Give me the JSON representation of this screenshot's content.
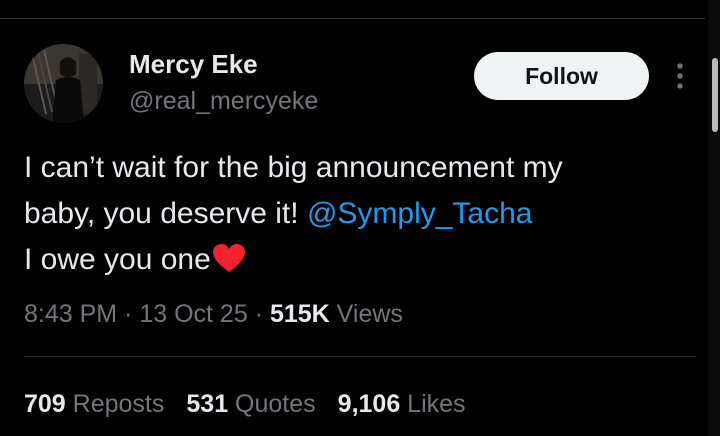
{
  "author": {
    "display_name": "Mercy Eke",
    "handle": "@real_mercyeke"
  },
  "actions": {
    "follow_label": "Follow"
  },
  "tweet": {
    "line1": "I can’t wait for the big announcement my",
    "line2_text": "baby, you deserve it! ",
    "mention": "@Symply_Tacha",
    "line3": "I owe you one",
    "emoji": "heart-emoji"
  },
  "meta": {
    "time": "8:43 PM",
    "sep1": " · ",
    "date": "13 Oct 25",
    "sep2": " · ",
    "views_count": "515K",
    "views_label": " Views"
  },
  "stats": {
    "reposts_count": "709",
    "reposts_label": " Reposts",
    "quotes_count": "531",
    "quotes_label": " Quotes",
    "likes_count": "9,106",
    "likes_label": " Likes"
  },
  "colors": {
    "background": "#000000",
    "primary_text": "#e7e9ea",
    "secondary_text": "#71767b",
    "link": "#1d9bf0",
    "heart": "#f4212e"
  }
}
